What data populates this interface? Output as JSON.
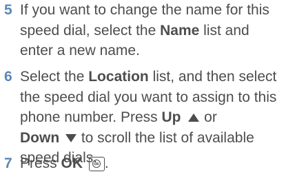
{
  "steps": [
    {
      "number": "5",
      "lines": [
        [
          "If you want to change the name for this"
        ],
        [
          "speed dial, select the ",
          "Name",
          " list and"
        ],
        [
          "enter a new name."
        ]
      ]
    },
    {
      "number": "6",
      "lines": [
        [
          "Select the ",
          "Location",
          " list, and then select"
        ],
        [
          "the speed dial you want to assign to this"
        ],
        [
          "phone number. Press ",
          "Up"
        ],
        [
          "Down",
          " to scroll the list of available"
        ],
        [
          "speed dials."
        ]
      ],
      "tail_or": " or"
    },
    {
      "number": "7",
      "lines": [
        [
          "Press ",
          "OK"
        ]
      ],
      "ok_key_label": "ok",
      "end_punct": "."
    }
  ],
  "colors": {
    "step_number": "#5b87b6",
    "text": "#4d4d4d"
  },
  "icons": [
    "up-arrow-icon",
    "down-arrow-icon",
    "ok-key-icon"
  ]
}
